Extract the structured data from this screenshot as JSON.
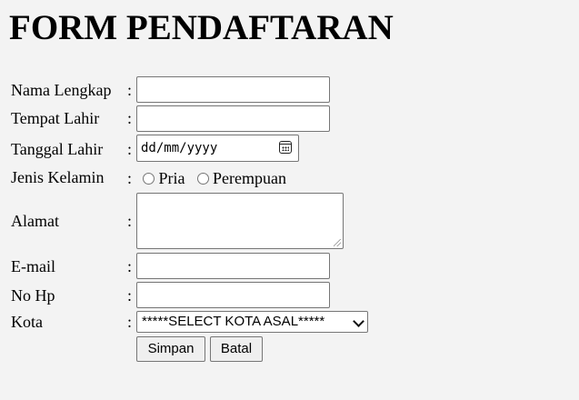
{
  "form": {
    "title": "FORM PENDAFTARAN",
    "colon": ":",
    "fields": {
      "nama": {
        "label": "Nama Lengkap",
        "value": ""
      },
      "tempat": {
        "label": "Tempat Lahir",
        "value": ""
      },
      "tanggal": {
        "label": "Tanggal Lahir",
        "placeholder": "dd/mm/yyyy"
      },
      "jenis_kelamin": {
        "label": "Jenis Kelamin",
        "options": [
          "Pria",
          "Perempuan"
        ],
        "selected": null
      },
      "alamat": {
        "label": "Alamat",
        "value": ""
      },
      "email": {
        "label": "E-mail",
        "value": ""
      },
      "nohp": {
        "label": "No Hp",
        "value": ""
      },
      "kota": {
        "label": "Kota",
        "selected_text": "*****SELECT KOTA ASAL*****"
      }
    },
    "buttons": {
      "simpan": "Simpan",
      "batal": "Batal"
    }
  }
}
